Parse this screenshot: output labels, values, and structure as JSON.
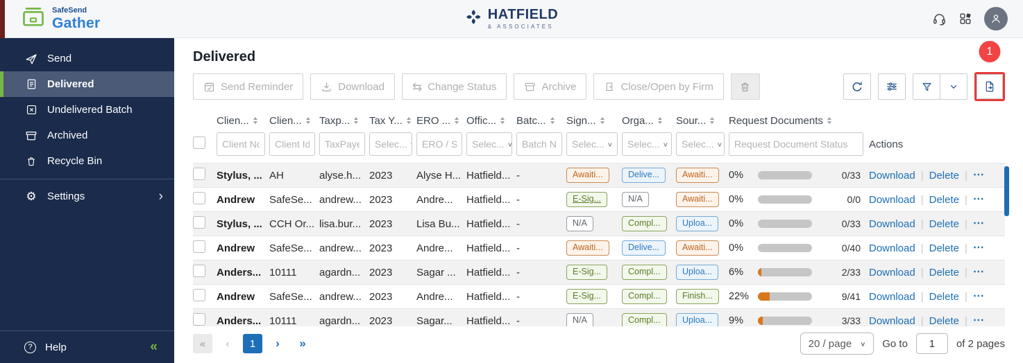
{
  "topbar": {
    "brand": {
      "name": "SafeSend",
      "product": "Gather",
      "icon": "safesend-box-icon"
    },
    "firm": {
      "name": "HATFIELD",
      "subtitle": "& ASSOCIATES",
      "icon": "hatfield-knot-icon"
    },
    "icons": [
      "headset-icon",
      "apps-grid-icon",
      "user-avatar"
    ]
  },
  "sidebar": {
    "items": [
      {
        "label": "Send",
        "icon": "send-icon",
        "active": false
      },
      {
        "label": "Delivered",
        "icon": "delivered-icon",
        "active": true
      },
      {
        "label": "Undelivered Batch",
        "icon": "undelivered-batch-icon",
        "active": false
      },
      {
        "label": "Archived",
        "icon": "archived-icon",
        "active": false
      },
      {
        "label": "Recycle Bin",
        "icon": "recycle-bin-icon",
        "active": false
      },
      {
        "label": "Settings",
        "icon": "settings-icon",
        "active": false,
        "chevron": true,
        "divider_above": true
      }
    ],
    "help": {
      "label": "Help",
      "icon": "help-icon",
      "collapse_glyph": "«"
    }
  },
  "main": {
    "title": "Delivered",
    "toolbar": {
      "actions": [
        {
          "label": "Send Reminder",
          "icon": "calendar-check-icon"
        },
        {
          "label": "Download",
          "icon": "download-icon"
        },
        {
          "label": "Change Status",
          "icon": "change-status-icon"
        },
        {
          "label": "Archive",
          "icon": "archive-icon"
        },
        {
          "label": "Close/Open by Firm",
          "icon": "door-icon"
        }
      ],
      "trash_icon": "trash-icon",
      "tools": [
        {
          "icon": "refresh-icon"
        },
        {
          "icon": "column-options-icon"
        },
        {
          "icon": "filter-icon"
        },
        {
          "icon": "chevron-down-icon"
        }
      ],
      "export": {
        "icon": "export-icon",
        "badge": "1",
        "highlighted": true
      }
    }
  },
  "table": {
    "columns": [
      {
        "label": "Clien..."
      },
      {
        "label": "Clien..."
      },
      {
        "label": "Taxp..."
      },
      {
        "label": "Tax Y..."
      },
      {
        "label": "ERO ..."
      },
      {
        "label": "Offic..."
      },
      {
        "label": "Batc..."
      },
      {
        "label": "Sign..."
      },
      {
        "label": "Orga..."
      },
      {
        "label": "Sour..."
      },
      {
        "label": "Request Documents"
      }
    ],
    "actions_header": "Actions",
    "filters": [
      {
        "type": "input",
        "placeholder": "Client Nc"
      },
      {
        "type": "input",
        "placeholder": "Client Id"
      },
      {
        "type": "input",
        "placeholder": "TaxPaye"
      },
      {
        "type": "select",
        "placeholder": "Selec..."
      },
      {
        "type": "input",
        "placeholder": "ERO / Sig"
      },
      {
        "type": "select",
        "placeholder": "Selec..."
      },
      {
        "type": "input",
        "placeholder": "Batch Nc"
      },
      {
        "type": "select",
        "placeholder": "Selec..."
      },
      {
        "type": "select",
        "placeholder": "Selec..."
      },
      {
        "type": "select",
        "placeholder": "Selec..."
      },
      {
        "type": "input",
        "placeholder": "Request Document Status"
      }
    ],
    "row_actions": {
      "download": "Download",
      "delete": "Delete",
      "more": "⋯"
    },
    "rows": [
      {
        "client_name": "Stylus, ...",
        "client_id": "AH",
        "taxpayer": "alyse.h...",
        "tax_year": "2023",
        "ero": "Alyse H...",
        "office": "Hatfield...",
        "batch": "-",
        "signature_status": {
          "label": "Awaiti...",
          "style": "orange"
        },
        "organizer_status": {
          "label": "Delive...",
          "style": "blue"
        },
        "source_doc_status": {
          "label": "Awaiti...",
          "style": "orange"
        },
        "percent": "0%",
        "progress_value": 0,
        "doc_count": "0/33"
      },
      {
        "client_name": "Andrew",
        "client_id": "SafeSe...",
        "taxpayer": "andrew...",
        "tax_year": "2023",
        "ero": "Andre...",
        "office": "Hatfield...",
        "batch": "-",
        "signature_status": {
          "label": "E-Sig...",
          "style": "green",
          "link": true
        },
        "organizer_status": {
          "label": "N/A",
          "style": "gray"
        },
        "source_doc_status": {
          "label": "Awaiti...",
          "style": "orange"
        },
        "percent": "0%",
        "progress_value": 0,
        "doc_count": "0/0"
      },
      {
        "client_name": "Stylus, ...",
        "client_id": "CCH Or...",
        "taxpayer": "lisa.bur...",
        "tax_year": "2023",
        "ero": "Lisa Bu...",
        "office": "Hatfield...",
        "batch": "-",
        "signature_status": {
          "label": "N/A",
          "style": "gray"
        },
        "organizer_status": {
          "label": "Compl...",
          "style": "green"
        },
        "source_doc_status": {
          "label": "Uploa...",
          "style": "blue"
        },
        "percent": "0%",
        "progress_value": 0,
        "doc_count": "0/33"
      },
      {
        "client_name": "Andrew",
        "client_id": "SafeSe...",
        "taxpayer": "andrew...",
        "tax_year": "2023",
        "ero": "Andre...",
        "office": "Hatfield...",
        "batch": "-",
        "signature_status": {
          "label": "Awaiti...",
          "style": "orange"
        },
        "organizer_status": {
          "label": "Delive...",
          "style": "blue"
        },
        "source_doc_status": {
          "label": "Awaiti...",
          "style": "orange"
        },
        "percent": "0%",
        "progress_value": 0,
        "doc_count": "0/40"
      },
      {
        "client_name": "Anders...",
        "client_id": "10111",
        "taxpayer": "agardn...",
        "tax_year": "2023",
        "ero": "Sagar ...",
        "office": "Hatfield...",
        "batch": "-",
        "signature_status": {
          "label": "E-Sig...",
          "style": "green"
        },
        "organizer_status": {
          "label": "Compl...",
          "style": "green"
        },
        "source_doc_status": {
          "label": "Uploa...",
          "style": "blue"
        },
        "percent": "6%",
        "progress_value": 6,
        "doc_count": "2/33"
      },
      {
        "client_name": "Andrew",
        "client_id": "SafeSe...",
        "taxpayer": "andrew...",
        "tax_year": "2023",
        "ero": "Andre...",
        "office": "Hatfield...",
        "batch": "-",
        "signature_status": {
          "label": "E-Sig...",
          "style": "green"
        },
        "organizer_status": {
          "label": "Compl...",
          "style": "green"
        },
        "source_doc_status": {
          "label": "Finish...",
          "style": "green"
        },
        "percent": "22%",
        "progress_value": 22,
        "doc_count": "9/41"
      },
      {
        "client_name": "Anders...",
        "client_id": "10111",
        "taxpayer": "agardn...",
        "tax_year": "2023",
        "ero": "Sagar...",
        "office": "Hatfield...",
        "batch": "-",
        "signature_status": {
          "label": "N/A",
          "style": "gray"
        },
        "organizer_status": {
          "label": "Compl...",
          "style": "green"
        },
        "source_doc_status": {
          "label": "Uploa...",
          "style": "blue"
        },
        "percent": "9%",
        "progress_value": 9,
        "doc_count": "3/33"
      }
    ]
  },
  "pagination": {
    "first": "«",
    "prev": "‹",
    "current": "1",
    "next": "›",
    "last": "»",
    "page_size": "20 / page",
    "goto_label": "Go to",
    "goto_value": "1",
    "pages_label": "of 2 pages"
  },
  "colors": {
    "accent_green": "#76b843",
    "brand_blue": "#2f7ed8",
    "sidebar_navy": "#1a2b4b",
    "link_blue": "#1d6fb8",
    "alert_red": "#f24444",
    "progress_fill": "#d9771c",
    "badge_orange": "#bc6420",
    "badge_blue": "#2d7abc",
    "badge_green": "#5a7c25"
  }
}
